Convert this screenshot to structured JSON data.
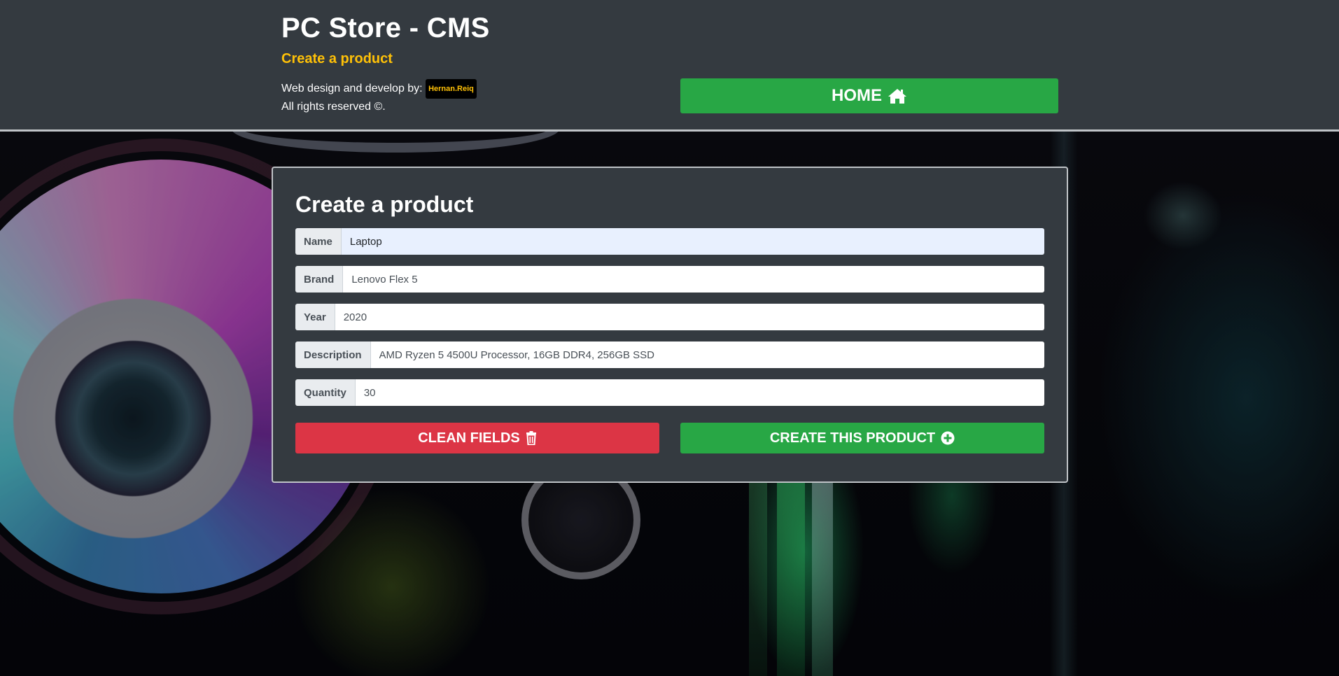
{
  "header": {
    "title": "PC Store - CMS",
    "subtitle": "Create a product",
    "credit_prefix": "Web design and develop by:",
    "author": "Hernan.Reiq",
    "rights": "All rights reserved ©.",
    "home_label": "HOME",
    "home_icon": "home-icon"
  },
  "form": {
    "title": "Create a product",
    "fields": [
      {
        "label": "Name",
        "value": "Laptop"
      },
      {
        "label": "Brand",
        "value": "Lenovo Flex 5"
      },
      {
        "label": "Year",
        "value": "2020"
      },
      {
        "label": "Description",
        "value": "AMD Ryzen 5 4500U Processor, 16GB DDR4, 256GB SSD"
      },
      {
        "label": "Quantity",
        "value": "30"
      }
    ],
    "clean_label": "CLEAN FIELDS",
    "clean_icon": "trash-icon",
    "create_label": "CREATE THIS PRODUCT",
    "create_icon": "plus-circle-icon"
  },
  "colors": {
    "header_bg": "#343a40",
    "accent": "#ffc107",
    "success": "#28a745",
    "danger": "#dc3545"
  }
}
